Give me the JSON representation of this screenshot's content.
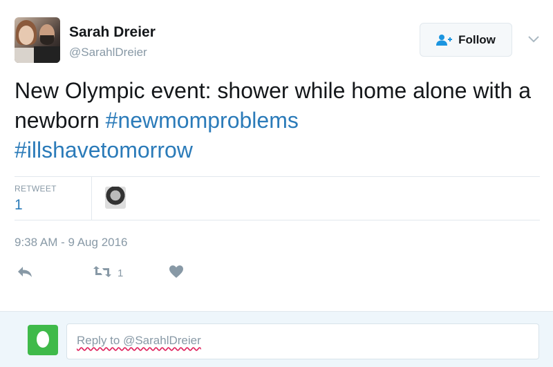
{
  "user": {
    "name": "Sarah Dreier",
    "handle": "@SarahlDreier"
  },
  "follow_button": {
    "label": "Follow"
  },
  "tweet": {
    "text_plain": "New Olympic event: shower while home alone with a newborn ",
    "hashtag1": "#newmomproblems",
    "hashtag2": "#illshavetomorrow",
    "timestamp": "9:38 AM - 9 Aug 2016"
  },
  "stats": {
    "retweet_label": "RETWEET",
    "retweet_count": "1"
  },
  "actions": {
    "retweet_count": "1"
  },
  "reply": {
    "placeholder": "Reply to @SarahlDreier"
  },
  "colors": {
    "hashtag": "#2b7bb9",
    "muted": "#8899a6",
    "reply_avatar": "#3fba4a",
    "reply_bg": "#eef6fb"
  },
  "icons": [
    "user-follow-icon",
    "chevron-down-icon",
    "reply-icon",
    "retweet-icon",
    "heart-icon",
    "egg-icon"
  ]
}
